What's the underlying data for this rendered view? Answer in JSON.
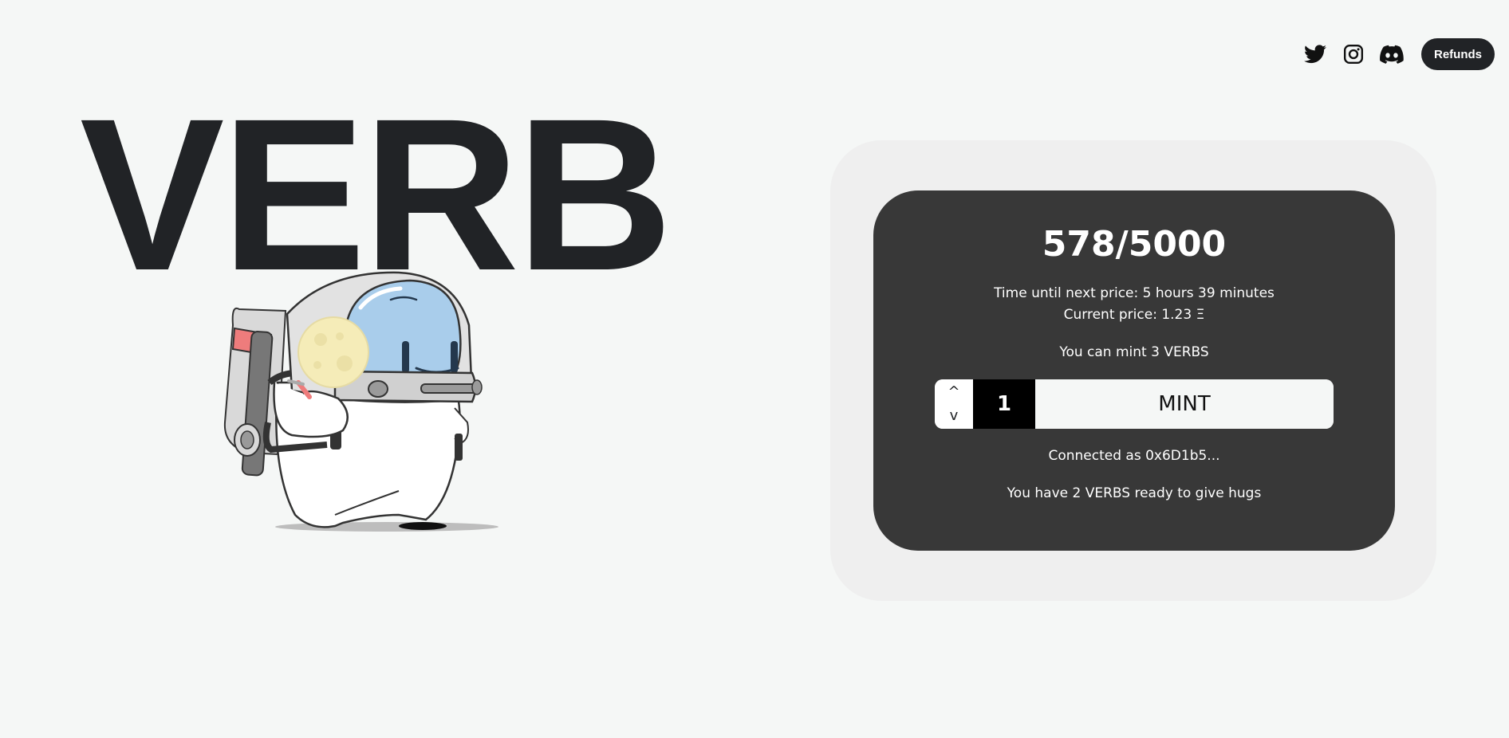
{
  "nav": {
    "icons": [
      "twitter-icon",
      "instagram-icon",
      "discord-icon"
    ],
    "refunds_label": "Refunds"
  },
  "hero": {
    "title": "VERB"
  },
  "mint": {
    "supply": "578/5000",
    "next_price": "Time until next price: 5 hours 39 minutes",
    "current_price": "Current price: 1.23 Ξ",
    "mint_limit": "You can mint 3 VERBS",
    "quantity": "1",
    "step_up": "^",
    "step_down": "v",
    "mint_label": "MINT",
    "connected": "Connected as 0x6D1b5...",
    "owned": "You have 2 VERBS ready to give hugs"
  },
  "colors": {
    "page_bg": "#f5f7f6",
    "text_dark": "#212326",
    "card_outer": "#efefef",
    "card_inner": "#383838",
    "helmet_glass": "#a9cdeb",
    "moon": "#f5ecb8"
  }
}
